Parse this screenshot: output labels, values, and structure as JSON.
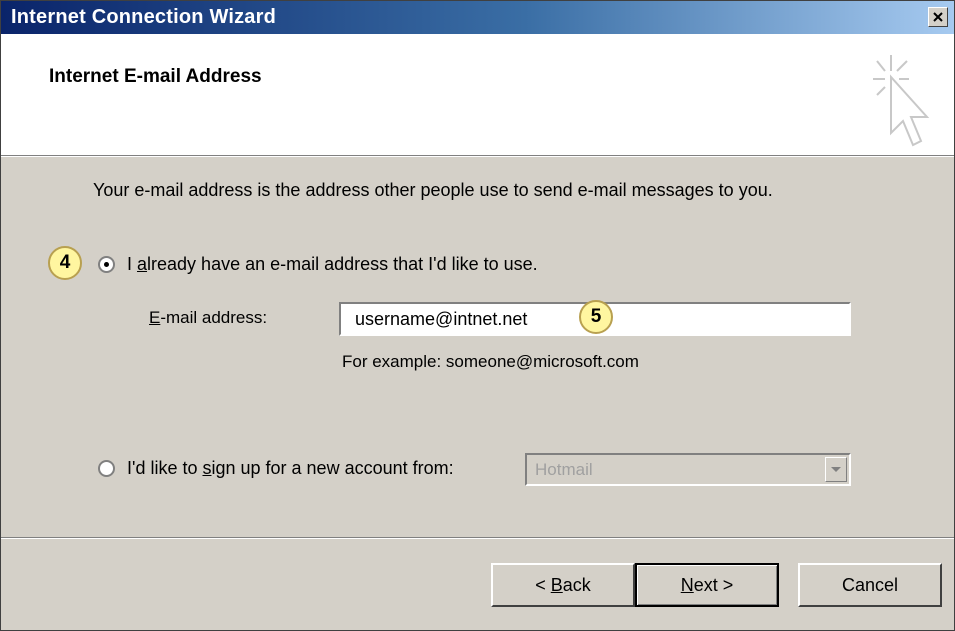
{
  "window": {
    "title": "Internet Connection Wizard"
  },
  "header": {
    "title": "Internet E-mail Address",
    "icon": "wizard-cursor-icon"
  },
  "description": "Your e-mail address is the address other people use to send e-mail messages to you.",
  "callouts": {
    "first": "4",
    "second": "5"
  },
  "option_existing": {
    "pre": "I ",
    "accel": "a",
    "post": "lready have an e-mail address that I'd like to use.",
    "selected": true
  },
  "email": {
    "label_accel": "E",
    "label_rest": "-mail address:",
    "value": "username@intnet.net",
    "hint": "For example: someone@microsoft.com"
  },
  "option_new": {
    "pre": "I'd like to ",
    "accel": "s",
    "post": "ign up for a new account from:",
    "selected": false,
    "provider": "Hotmail"
  },
  "buttons": {
    "back_pre": "< ",
    "back_accel": "B",
    "back_post": "ack",
    "next_accel": "N",
    "next_post": "ext >",
    "cancel": "Cancel"
  }
}
